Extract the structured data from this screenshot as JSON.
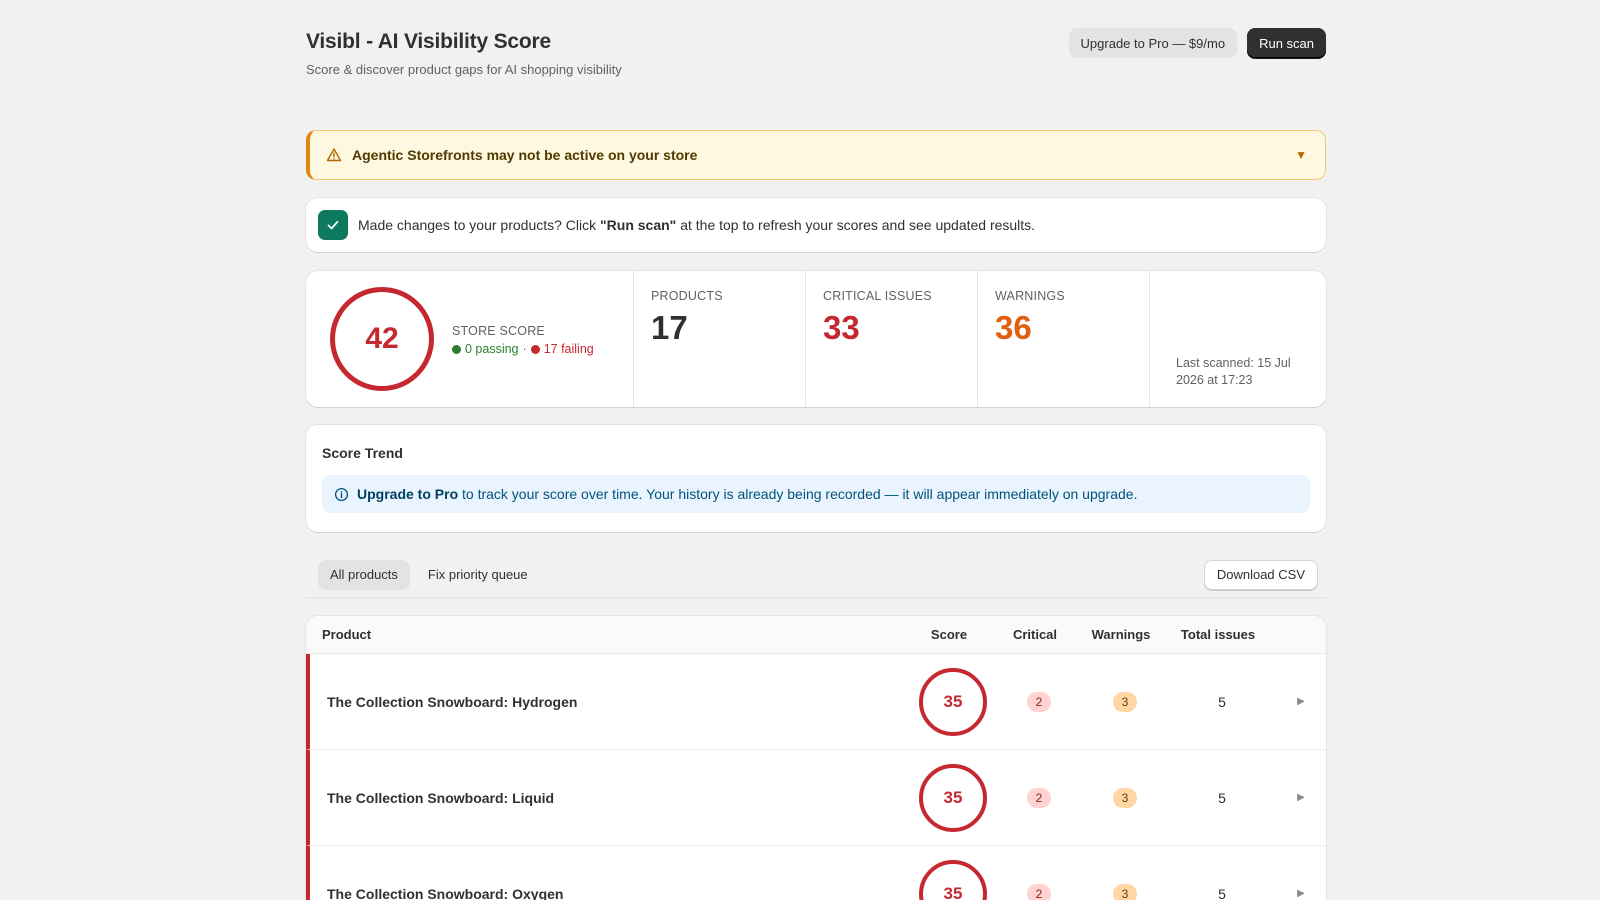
{
  "header": {
    "title": "Visibl - AI Visibility Score",
    "subtitle": "Score & discover product gaps for AI shopping visibility",
    "upgrade_label": "Upgrade to Pro — $9/mo",
    "scan_label": "Run scan"
  },
  "banner": {
    "text": "Agentic Storefronts may not be active on your store",
    "icon": "warning-triangle-icon",
    "toggle_icon": "chevron-down-icon"
  },
  "info": {
    "text_before": "Made changes to your products? Click ",
    "text_bold": "\"Run scan\"",
    "text_after": " at the top to refresh your scores and see updated results.",
    "icon": "check-icon"
  },
  "stats": {
    "store_score": "42",
    "store_score_label": "STORE SCORE",
    "passing": "0 passing",
    "separator": "·",
    "failing": "17 failing",
    "products_label": "PRODUCTS",
    "products": "17",
    "critical_label": "CRITICAL ISSUES",
    "critical": "33",
    "warnings_label": "WARNINGS",
    "warnings": "36",
    "last_scanned": "Last scanned: 15 Jul 2026 at 17:23"
  },
  "trend": {
    "title": "Score Trend",
    "link": "Upgrade to Pro",
    "note": " to track your score over time. Your history is already being recorded — it will appear immediately on upgrade.",
    "icon": "info-icon"
  },
  "tabs": [
    {
      "label": "All products",
      "active": true
    },
    {
      "label": "Fix priority queue",
      "active": false
    }
  ],
  "download_label": "Download CSV",
  "table": {
    "columns": [
      "Product",
      "Score",
      "Critical",
      "Warnings",
      "Total issues"
    ],
    "rows": [
      {
        "product": "The Collection Snowboard: Hydrogen",
        "score": "35",
        "critical": "2",
        "warnings": "3",
        "total": "5"
      },
      {
        "product": "The Collection Snowboard: Liquid",
        "score": "35",
        "critical": "2",
        "warnings": "3",
        "total": "5"
      },
      {
        "product": "The Collection Snowboard: Oxygen",
        "score": "35",
        "critical": "2",
        "warnings": "3",
        "total": "5"
      }
    ]
  },
  "colors": {
    "critical": "#c5282f",
    "warning": "#e0600f",
    "passing": "#2e7d32",
    "accent": "#0d7a5f"
  }
}
